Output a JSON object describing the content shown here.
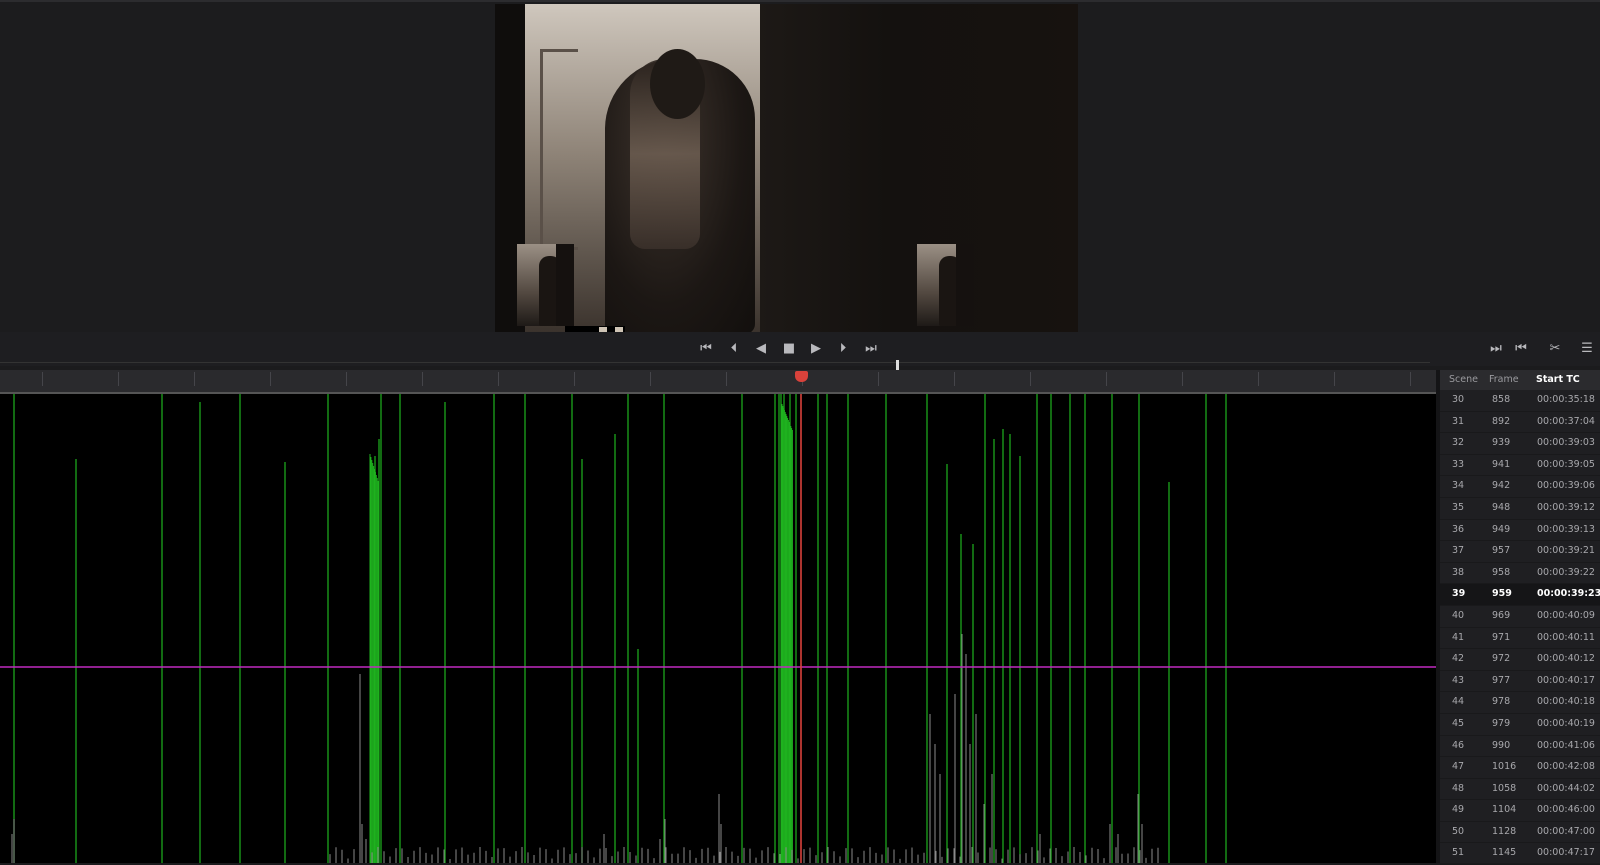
{
  "transport": {
    "left_buttons": [
      {
        "name": "go-to-start-button",
        "icon": "⏮"
      },
      {
        "name": "prev-frame-button",
        "icon": "⏴"
      },
      {
        "name": "reverse-button",
        "icon": "◀"
      },
      {
        "name": "stop-button",
        "icon": "■"
      },
      {
        "name": "play-button",
        "icon": "▶"
      },
      {
        "name": "next-frame-button",
        "icon": "⏵"
      },
      {
        "name": "go-to-end-button",
        "icon": "⏭"
      }
    ],
    "right_buttons": [
      {
        "name": "next-edit-button",
        "icon": "⏭"
      },
      {
        "name": "prev-edit-button",
        "icon": "⏮"
      },
      {
        "name": "cut-button",
        "icon": "✂"
      },
      {
        "name": "list-view-button",
        "icon": "☰"
      }
    ]
  },
  "scene_list": {
    "headers": {
      "scene": "Scene",
      "frame": "Frame",
      "start_tc": "Start TC"
    },
    "rows": [
      {
        "scene": "30",
        "frame": "858",
        "tc": "00:00:35:18"
      },
      {
        "scene": "31",
        "frame": "892",
        "tc": "00:00:37:04"
      },
      {
        "scene": "32",
        "frame": "939",
        "tc": "00:00:39:03"
      },
      {
        "scene": "33",
        "frame": "941",
        "tc": "00:00:39:05"
      },
      {
        "scene": "34",
        "frame": "942",
        "tc": "00:00:39:06"
      },
      {
        "scene": "35",
        "frame": "948",
        "tc": "00:00:39:12"
      },
      {
        "scene": "36",
        "frame": "949",
        "tc": "00:00:39:13"
      },
      {
        "scene": "37",
        "frame": "957",
        "tc": "00:00:39:21"
      },
      {
        "scene": "38",
        "frame": "958",
        "tc": "00:00:39:22"
      },
      {
        "scene": "39",
        "frame": "959",
        "tc": "00:00:39:23",
        "selected": true
      },
      {
        "scene": "40",
        "frame": "969",
        "tc": "00:00:40:09"
      },
      {
        "scene": "41",
        "frame": "971",
        "tc": "00:00:40:11"
      },
      {
        "scene": "42",
        "frame": "972",
        "tc": "00:00:40:12"
      },
      {
        "scene": "43",
        "frame": "977",
        "tc": "00:00:40:17"
      },
      {
        "scene": "44",
        "frame": "978",
        "tc": "00:00:40:18"
      },
      {
        "scene": "45",
        "frame": "979",
        "tc": "00:00:40:19"
      },
      {
        "scene": "46",
        "frame": "990",
        "tc": "00:00:41:06"
      },
      {
        "scene": "47",
        "frame": "1016",
        "tc": "00:00:42:08"
      },
      {
        "scene": "48",
        "frame": "1058",
        "tc": "00:00:44:02"
      },
      {
        "scene": "49",
        "frame": "1104",
        "tc": "00:00:46:00"
      },
      {
        "scene": "50",
        "frame": "1128",
        "tc": "00:00:47:00"
      },
      {
        "scene": "51",
        "frame": "1145",
        "tc": "00:00:47:17"
      }
    ]
  },
  "colors": {
    "cut_line": "#1fb21f",
    "threshold_line": "#c02bc0",
    "playhead": "#d9423b",
    "waveform": "#8a8a8a"
  }
}
